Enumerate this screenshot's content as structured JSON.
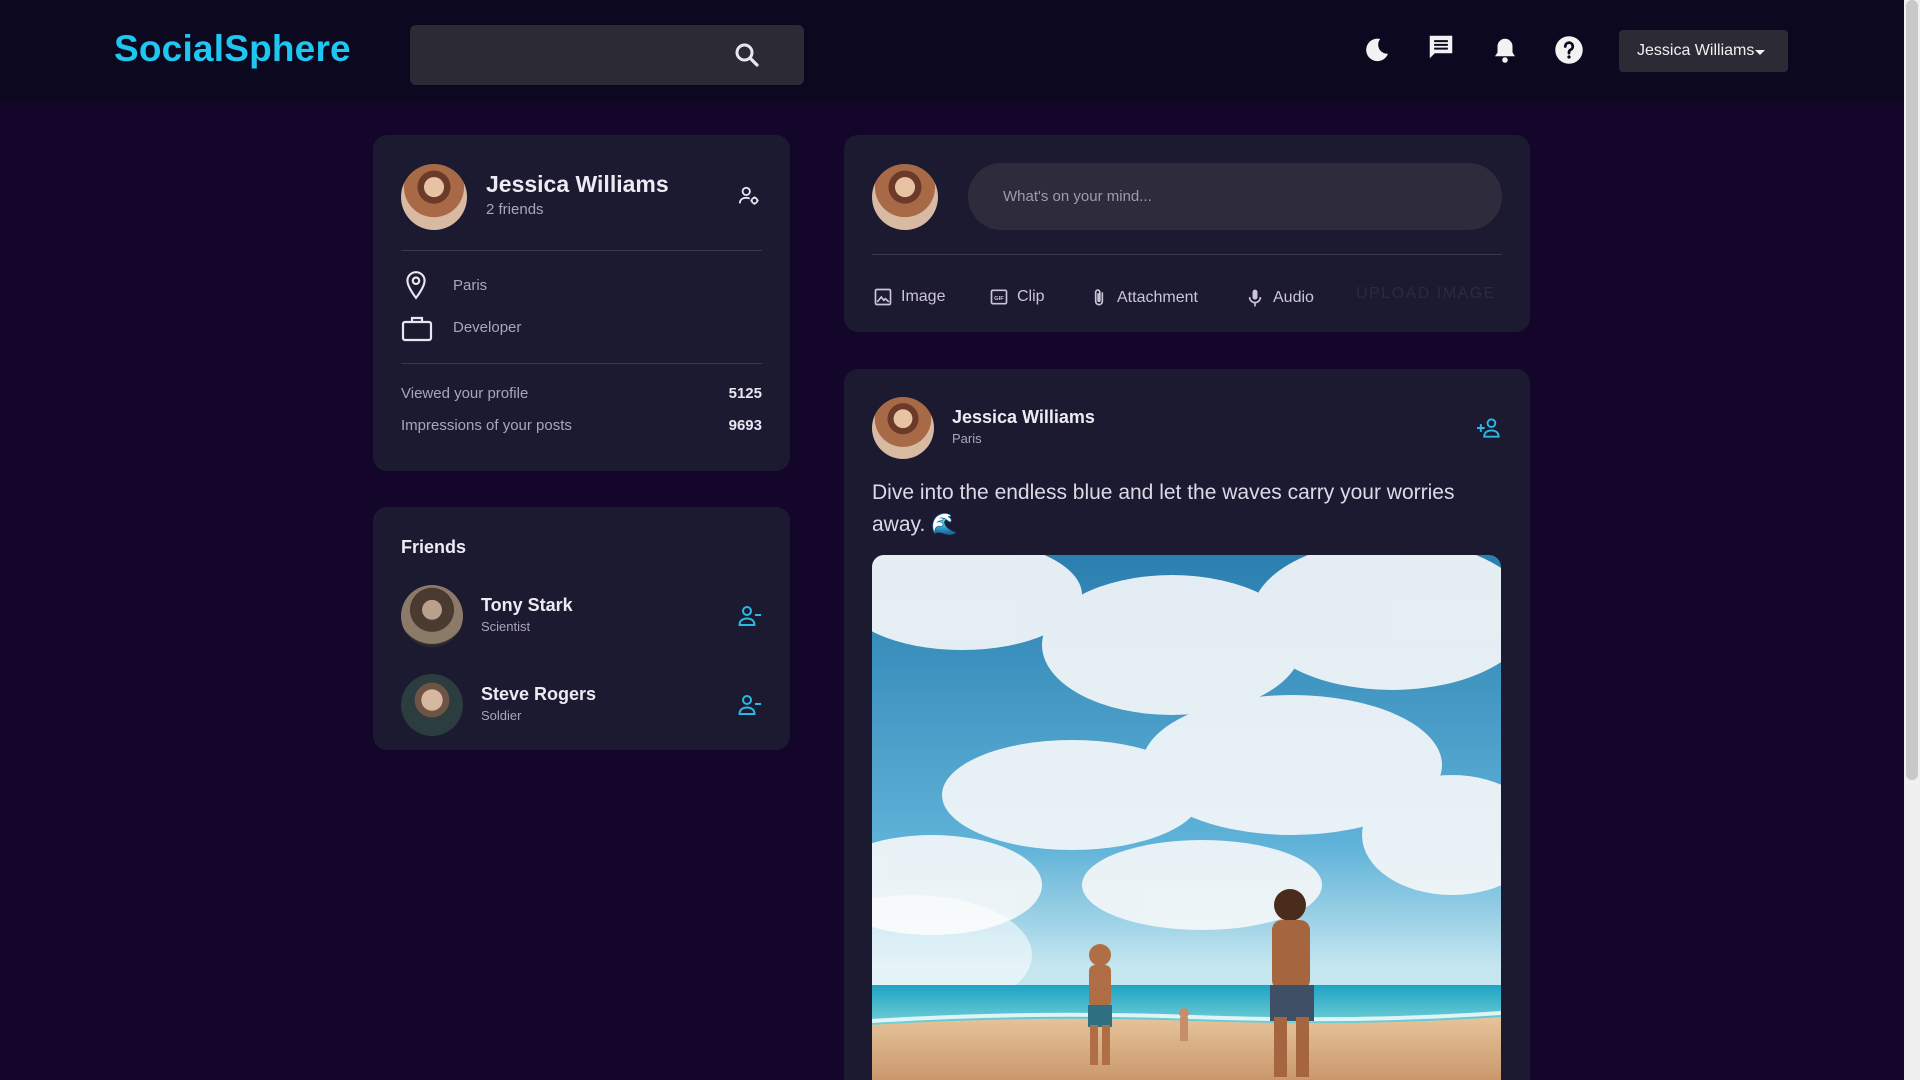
{
  "navbar": {
    "brand": "SocialSphere",
    "search": {
      "placeholder": "",
      "value": ""
    },
    "icons": [
      "dark-mode-icon",
      "message-icon",
      "notification-icon",
      "help-icon"
    ],
    "user_select": "Jessica Williams"
  },
  "profile": {
    "name": "Jessica Williams",
    "friends_count": "2 friends",
    "location": "Paris",
    "occupation": "Developer",
    "stats": [
      {
        "label": "Viewed your profile",
        "value": "5125"
      },
      {
        "label": "Impressions of your posts",
        "value": "9693"
      }
    ]
  },
  "friends": {
    "title": "Friends",
    "items": [
      {
        "name": "Tony Stark",
        "occupation": "Scientist"
      },
      {
        "name": "Steve Rogers",
        "occupation": "Soldier"
      }
    ]
  },
  "composer": {
    "placeholder": "What's on your mind...",
    "actions": [
      "Image",
      "Clip",
      "Attachment",
      "Audio"
    ],
    "upload_label": "UPLOAD IMAGE"
  },
  "post": {
    "author": "Jessica Williams",
    "location": "Paris",
    "text": "Dive into the endless blue and let the waves carry your worries away. 🌊"
  },
  "colors": {
    "accent": "#1ec6f0",
    "background": "#14052a",
    "card": "#1c1a31"
  }
}
